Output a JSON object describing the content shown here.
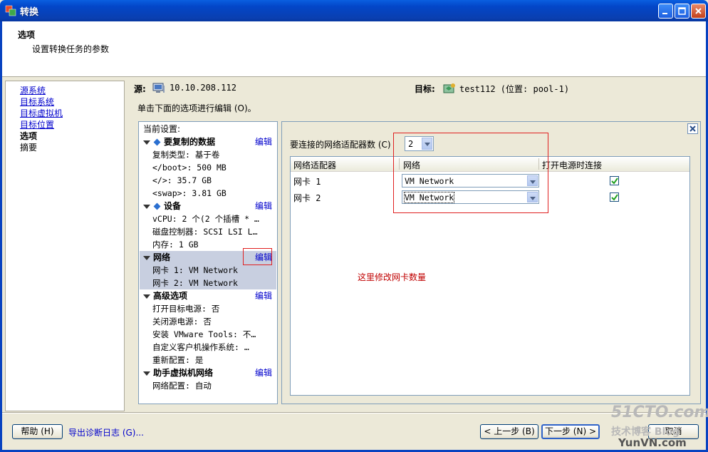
{
  "window": {
    "title": "转换"
  },
  "header": {
    "title": "选项",
    "subtitle": "设置转换任务的参数"
  },
  "nav": {
    "items": [
      {
        "label": "源系统",
        "state": "link"
      },
      {
        "label": "目标系统",
        "state": "link"
      },
      {
        "label": "目标虚拟机",
        "state": "link"
      },
      {
        "label": "目标位置",
        "state": "link"
      },
      {
        "label": "选项",
        "state": "current"
      },
      {
        "label": "摘要",
        "state": "plain"
      }
    ]
  },
  "source": {
    "label": "源:",
    "value": "10.10.208.112",
    "icon": "computer-icon"
  },
  "target": {
    "label": "目标:",
    "value": "test112 (位置: pool-1)",
    "icon": "vm-host-icon"
  },
  "instruction": "单击下面的选项进行编辑 (O)。",
  "settings": {
    "header": "当前设置:",
    "edit_label": "编辑",
    "sections": [
      {
        "title": "要复制的数据",
        "items": [
          "复制类型: 基于卷",
          "</boot>: 500 MB",
          "</>: 35.7 GB",
          "<swap>: 3.81 GB"
        ]
      },
      {
        "title": "设备",
        "items": [
          "vCPU: 2 个(2 个插槽 * …",
          "磁盘控制器: SCSI LSI L…",
          "内存: 1 GB"
        ]
      },
      {
        "title": "网络",
        "items": [
          "网卡 1: VM Network",
          "网卡 2: VM Network"
        ],
        "selected": true
      },
      {
        "title": "高级选项",
        "items": [
          "打开目标电源: 否",
          "关闭源电源: 否",
          "安装 VMware Tools: 不…",
          "自定义客户机操作系统: …",
          "重新配置: 是"
        ]
      },
      {
        "title": "助手虚拟机网络",
        "items": [
          "网络配置: 自动"
        ]
      }
    ]
  },
  "network_panel": {
    "adapter_count_label": "要连接的网络适配器数 (C)",
    "adapter_count_value": "2",
    "columns": [
      "网络适配器",
      "网络",
      "打开电源时连接"
    ],
    "rows": [
      {
        "adapter": "网卡 1",
        "network": "VM Network",
        "connect": true
      },
      {
        "adapter": "网卡 2",
        "network": "VM Network",
        "connect": true
      }
    ]
  },
  "annotation": "这里修改网卡数量",
  "footer": {
    "help": "帮助 (H)",
    "export": "导出诊断日志 (G)...",
    "back": "< 上一步 (B)",
    "next": "下一步 (N) >",
    "cancel": "取消"
  },
  "watermark": {
    "line1": "51CTO.com",
    "line2": "技术博客 Blog",
    "line3": "YunVN.com"
  },
  "colors": {
    "titlebar": "#0346c8",
    "link": "#0000cc",
    "annotation": "#c00000",
    "highlight": "#c8cfe0"
  }
}
